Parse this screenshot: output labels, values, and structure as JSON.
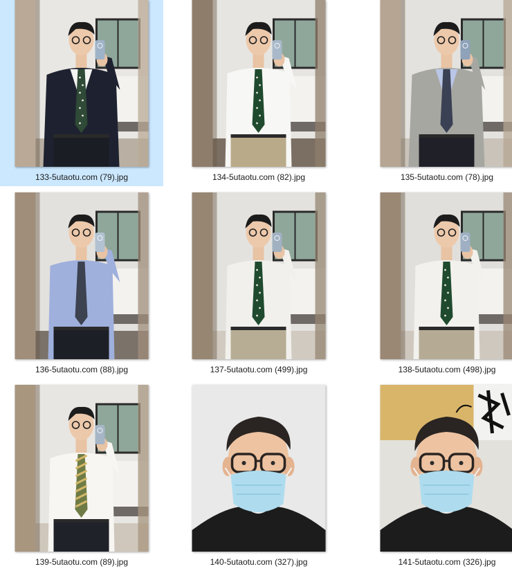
{
  "files": [
    {
      "name": "133-5utaotu.com (79).jpg",
      "selected": true,
      "photo": {
        "kind": "mirror",
        "jacket": "#1e2230",
        "shirt": "#f4f4f2",
        "tie": "#2f4a36",
        "tieDots": true,
        "pants": "#1b1d24",
        "wall": "#e9e7e3",
        "floor": "#b9b0a3",
        "door": "#b9a996",
        "phone": "#9fb3c8"
      }
    },
    {
      "name": "134-5utaotu.com (82).jpg",
      "selected": false,
      "photo": {
        "kind": "mirror",
        "jacket": null,
        "shirt": "#f7f7f5",
        "tie": "#1f4a2e",
        "tieDots": true,
        "pants": "#b9ab8a",
        "wall": "#e7e5e1",
        "floor": "#7b6f63",
        "door": "#8f7d6b",
        "phone": "#a9b9c9"
      }
    },
    {
      "name": "135-5utaotu.com (78).jpg",
      "selected": false,
      "photo": {
        "kind": "mirror",
        "jacket": "#a7a7a2",
        "shirt": "#b9c6e8",
        "tie": "#3b4154",
        "tieDots": false,
        "pants": "#1f2028",
        "wall": "#e4e2de",
        "floor": "#c9c3ba",
        "door": "#b5a592",
        "phone": "#8ea2b9"
      }
    },
    {
      "name": "136-5utaotu.com (88).jpg",
      "selected": false,
      "photo": {
        "kind": "mirror",
        "jacket": null,
        "shirt": "#9fb0dd",
        "tie": "#3d4250",
        "tieDots": false,
        "pants": "#1d1f26",
        "wall": "#e3e1dd",
        "floor": "#7b726a",
        "door": "#a08e7b",
        "phone": "#b3c2d2"
      }
    },
    {
      "name": "137-5utaotu.com (499).jpg",
      "selected": false,
      "photo": {
        "kind": "mirror",
        "jacket": null,
        "shirt": "#f1f0ec",
        "tie": "#1f4a2e",
        "tieDots": true,
        "pants": "#b7ad95",
        "wall": "#e4e2de",
        "floor": "#d1cac0",
        "door": "#968672",
        "phone": "#a1b1c2"
      }
    },
    {
      "name": "138-5utaotu.com (498).jpg",
      "selected": false,
      "photo": {
        "kind": "mirror",
        "jacket": null,
        "shirt": "#f2f1ed",
        "tie": "#1f4a2e",
        "tieDots": true,
        "pants": "#b5ab95",
        "wall": "#e1dfdb",
        "floor": "#cfc8bf",
        "door": "#9a8875",
        "phone": "#9fb0c4"
      }
    },
    {
      "name": "139-5utaotu.com (89).jpg",
      "selected": false,
      "photo": {
        "kind": "mirror",
        "jacket": null,
        "shirt": "#f7f6f2",
        "tie": "#6e7b45",
        "tieDots": false,
        "tieStripes": true,
        "pants": "#20222a",
        "wall": "#e8e6e2",
        "floor": "#cfc7bc",
        "door": "#a8967f",
        "phone": "#a6b6c6"
      }
    },
    {
      "name": "140-5utaotu.com (327).jpg",
      "selected": false,
      "photo": {
        "kind": "selfie",
        "bg": "#e9e9e9",
        "shirt": "#1c1c1c",
        "mask": "#aedcee",
        "art": false
      }
    },
    {
      "name": "141-5utaotu.com (326).jpg",
      "selected": false,
      "photo": {
        "kind": "selfie",
        "bg": "#e3e1dc",
        "shirt": "#1c1c1c",
        "mask": "#aedcee",
        "art": true
      }
    }
  ]
}
